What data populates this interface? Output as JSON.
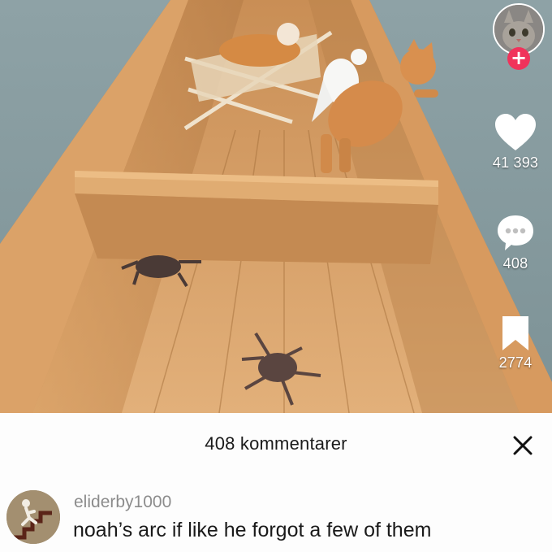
{
  "video": {
    "scene_description": "",
    "colors": {
      "water": "#8fa3a6",
      "hull": "#c9925a",
      "wood": "#d8a26a"
    }
  },
  "creator": {
    "avatar_icon": "cat-avatar-icon",
    "follow_label": "+"
  },
  "actions": {
    "likes": {
      "icon": "heart-icon",
      "count": "41 393"
    },
    "comments": {
      "icon": "comment-bubble-icon",
      "count": "408"
    },
    "saves": {
      "icon": "bookmark-icon",
      "count": "2774"
    }
  },
  "comments_sheet": {
    "title": "408 kommentarer",
    "close_icon": "close-icon",
    "comments": [
      {
        "username": "eliderby1000",
        "text": "noah’s arc if like he forgot a few of them",
        "avatar_icon": "stairs-figure-avatar-icon"
      }
    ]
  },
  "colors": {
    "accent": "#f0335b",
    "sheet_bg": "#fdfdfd",
    "username": "#8c8c8c"
  }
}
